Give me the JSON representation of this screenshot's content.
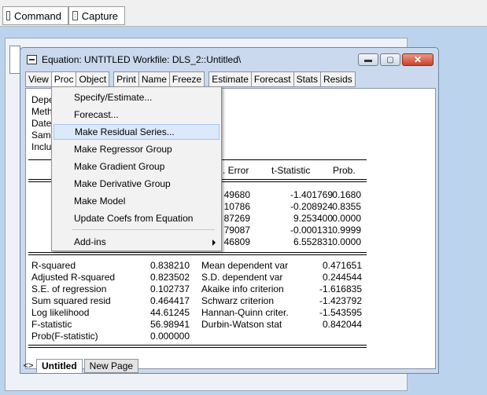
{
  "top_tabs": {
    "command": "Command",
    "capture": "Capture"
  },
  "window": {
    "title": "Equation: UNTITLED   Workfile: DLS_2::Untitled\\",
    "controls": {
      "minimize": "▬",
      "maximize": "▢",
      "close": "✕"
    }
  },
  "toolbar": {
    "view": "View",
    "proc": "Proc",
    "object": "Object",
    "print": "Print",
    "name": "Name",
    "freeze": "Freeze",
    "estimate": "Estimate",
    "forecast": "Forecast",
    "stats": "Stats",
    "resids": "Resids"
  },
  "header_partial": [
    "Depe",
    "Meth",
    "Date",
    "Sam",
    "Inclu"
  ],
  "coef_header": {
    "std_error_partial": ". Error",
    "t_statistic": "t-Statistic",
    "prob": "Prob."
  },
  "coef_rows": [
    {
      "se": "49680",
      "t": "-1.401769",
      "p": "0.1680"
    },
    {
      "se": "10786",
      "t": "-0.208924",
      "p": "0.8355"
    },
    {
      "se": "87269",
      "t": "9.253400",
      "p": "0.0000"
    },
    {
      "se": "79087",
      "t": "-0.000131",
      "p": "0.9999"
    },
    {
      "se": "46809",
      "t": "6.552831",
      "p": "0.0000"
    }
  ],
  "stats_left": [
    {
      "label": "R-squared",
      "value": "0.838210"
    },
    {
      "label": "Adjusted R-squared",
      "value": "0.823502"
    },
    {
      "label": "S.E. of regression",
      "value": "0.102737"
    },
    {
      "label": "Sum squared resid",
      "value": "0.464417"
    },
    {
      "label": "Log likelihood",
      "value": "44.61245"
    },
    {
      "label": "F-statistic",
      "value": "56.98941"
    },
    {
      "label": "Prob(F-statistic)",
      "value": "0.000000"
    }
  ],
  "stats_right": [
    {
      "label": "Mean dependent var",
      "value": "0.471651"
    },
    {
      "label": "S.D. dependent var",
      "value": "0.244544"
    },
    {
      "label": "Akaike info criterion",
      "value": "-1.616835"
    },
    {
      "label": "Schwarz criterion",
      "value": "-1.423792"
    },
    {
      "label": "Hannan-Quinn criter.",
      "value": "-1.543595"
    },
    {
      "label": "Durbin-Watson stat",
      "value": "0.842044"
    }
  ],
  "proc_menu": [
    "Specify/Estimate...",
    "Forecast...",
    "Make Residual Series...",
    "Make Regressor Group",
    "Make Gradient Group",
    "Make Derivative Group",
    "Make Model",
    "Update Coefs from Equation",
    "Add-ins"
  ],
  "bottom_tabs": {
    "nav": "<>",
    "untitled": "Untitled",
    "new_page": "New Page"
  }
}
